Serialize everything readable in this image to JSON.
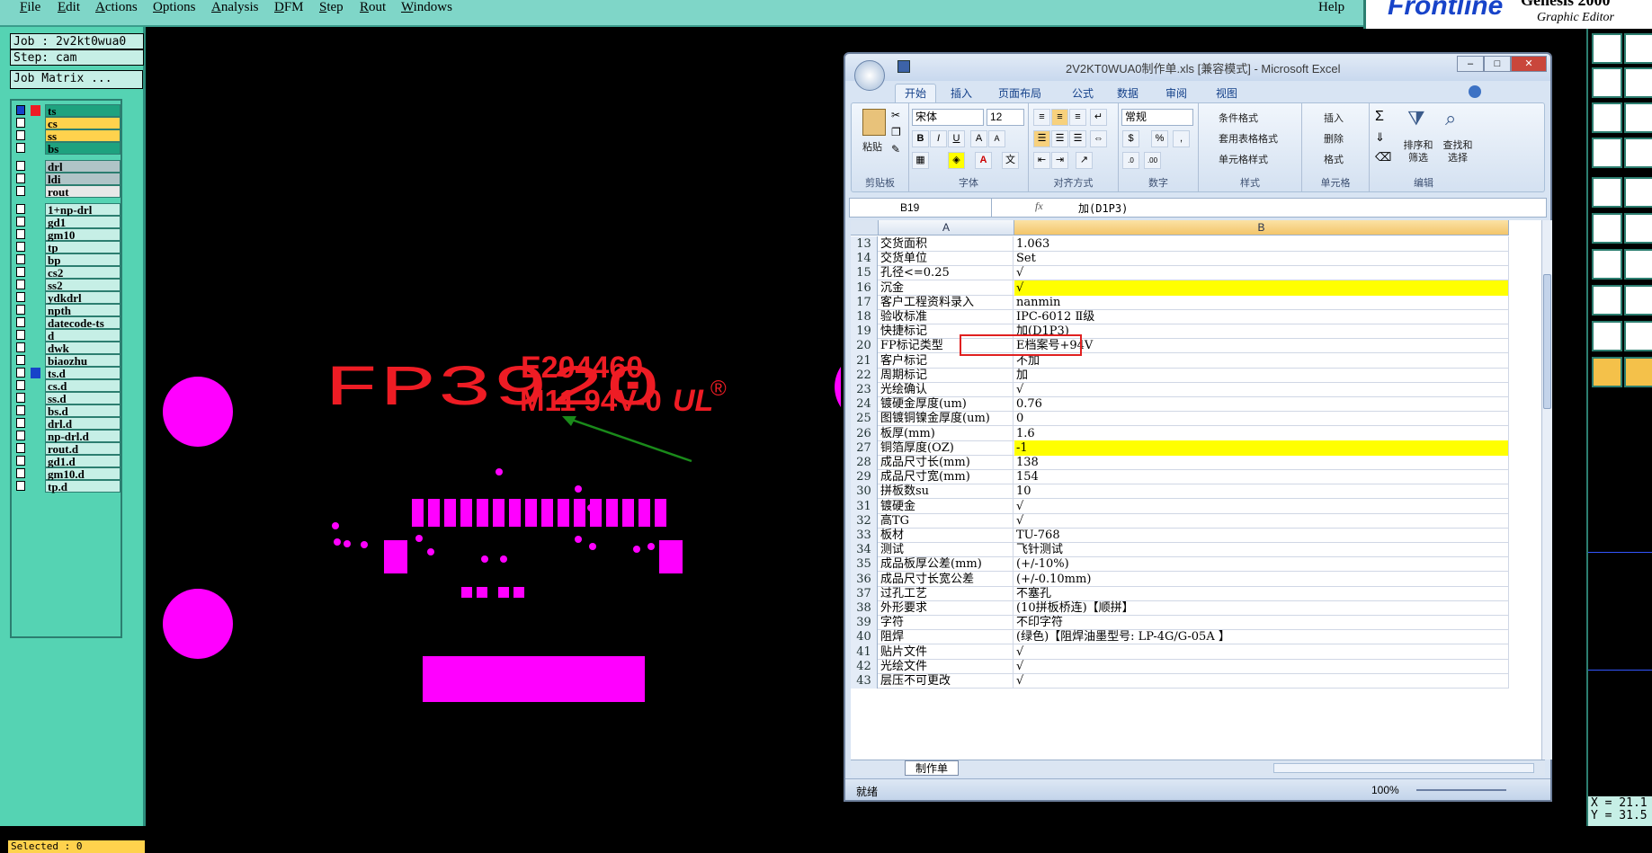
{
  "menubar": {
    "items": [
      {
        "label": "File",
        "u": "F"
      },
      {
        "label": "Edit",
        "u": "E"
      },
      {
        "label": "Actions",
        "u": "A"
      },
      {
        "label": "Options",
        "u": "O"
      },
      {
        "label": "Analysis",
        "u": "A"
      },
      {
        "label": "DFM",
        "u": "D"
      },
      {
        "label": "Step",
        "u": "S"
      },
      {
        "label": "Rout",
        "u": "R"
      },
      {
        "label": "Windows",
        "u": "W"
      }
    ],
    "help": "Help",
    "logo": "Frontline",
    "logo_product": "Genesis 2000",
    "logo_sub": "Graphic Editor"
  },
  "left": {
    "job": "Job : 2v2kt0wua0",
    "step": "Step: cam",
    "matrix_button": "Job Matrix ...",
    "selected": "Selected : 0",
    "layers": [
      "ts",
      "cs",
      "ss",
      "bs",
      "drl",
      "ldi",
      "rout",
      "1+np-drl",
      "gd1",
      "gm10",
      "tp",
      "bp",
      "cs2",
      "ss2",
      "ydkdrl",
      "npth",
      "datecode-ts",
      "d",
      "dwk",
      "biaozhu",
      "ts.d",
      "cs.d",
      "ss.d",
      "bs.d",
      "drl.d",
      "np-drl.d",
      "rout.d",
      "gd1.d",
      "gm10.d",
      "tp.d"
    ]
  },
  "canvas": {
    "fp_text": "FP3920",
    "ul_number": "E204460",
    "ul_rating": "M11 94V-0",
    "ul_mark": "UL",
    "registered": "®"
  },
  "coords": {
    "x": "X = 21.1",
    "y": "Y = 31.5"
  },
  "excel": {
    "title": "2V2KT0WUA0制作单.xls [兼容模式] - Microsoft Excel",
    "tabs": [
      "开始",
      "插入",
      "页面布局",
      "公式",
      "数据",
      "审阅",
      "视图"
    ],
    "ribbon": {
      "paste": "粘贴",
      "clipboard": "剪贴板",
      "font_name": "宋体",
      "font_size": "12",
      "font": "字体",
      "align": "对齐方式",
      "number_format": "常规",
      "number": "数字",
      "cond_format": "条件格式",
      "table_format": "套用表格格式",
      "cell_style": "单元格样式",
      "styles": "样式",
      "insert": "插入",
      "delete": "删除",
      "format": "格式",
      "cells": "单元格",
      "sort_filter": "排序和筛选",
      "find_select": "查找和选择",
      "editing": "编辑"
    },
    "namebox": "B19",
    "fx": "fx",
    "formula": "加(D1P3)",
    "col_a": "A",
    "col_b": "B",
    "rows": [
      {
        "n": "13",
        "a": "交货面积",
        "b": "1.063",
        "y": false
      },
      {
        "n": "14",
        "a": "交货单位",
        "b": "Set",
        "y": false
      },
      {
        "n": "15",
        "a": "孔径<=0.25",
        "b": "√",
        "y": false
      },
      {
        "n": "16",
        "a": "沉金",
        "b": "√",
        "y": true
      },
      {
        "n": "17",
        "a": "客户工程资料录入",
        "b": "nanmin",
        "y": false
      },
      {
        "n": "18",
        "a": "验收标准",
        "b": "IPC-6012 Ⅱ级",
        "y": false
      },
      {
        "n": "19",
        "a": "快捷标记",
        "b": "加(D1P3)",
        "y": false
      },
      {
        "n": "20",
        "a": "FP标记类型",
        "b": "E档案号+94V",
        "y": false
      },
      {
        "n": "21",
        "a": "客户标记",
        "b": "不加",
        "y": false
      },
      {
        "n": "22",
        "a": "周期标记",
        "b": "加",
        "y": false
      },
      {
        "n": "23",
        "a": "光绘确认",
        "b": "√",
        "y": false
      },
      {
        "n": "24",
        "a": "镀硬金厚度(um)",
        "b": "0.76",
        "y": false
      },
      {
        "n": "25",
        "a": "图镀铜镍金厚度(um)",
        "b": "0",
        "y": false
      },
      {
        "n": "26",
        "a": "板厚(mm)",
        "b": "1.6",
        "y": false
      },
      {
        "n": "27",
        "a": "铜箔厚度(OZ)",
        "b": "-1",
        "y": true
      },
      {
        "n": "28",
        "a": "成品尺寸长(mm)",
        "b": "138",
        "y": false
      },
      {
        "n": "29",
        "a": "成品尺寸宽(mm)",
        "b": "154",
        "y": false
      },
      {
        "n": "30",
        "a": "拼板数su",
        "b": "10",
        "y": false
      },
      {
        "n": "31",
        "a": "镀硬金",
        "b": "√",
        "y": false
      },
      {
        "n": "32",
        "a": "高TG",
        "b": "√",
        "y": false
      },
      {
        "n": "33",
        "a": "板材",
        "b": "TU-768",
        "y": false
      },
      {
        "n": "34",
        "a": "测试",
        "b": "飞针测试",
        "y": false
      },
      {
        "n": "35",
        "a": "成品板厚公差(mm)",
        "b": "(+/-10%)",
        "y": false
      },
      {
        "n": "36",
        "a": "成品尺寸长宽公差",
        "b": "(+/-0.10mm)",
        "y": false
      },
      {
        "n": "37",
        "a": "过孔工艺",
        "b": "不塞孔",
        "y": false
      },
      {
        "n": "38",
        "a": "外形要求",
        "b": "(10拼板桥连)【顺拼】",
        "y": false
      },
      {
        "n": "39",
        "a": "字符",
        "b": "不印字符",
        "y": false
      },
      {
        "n": "40",
        "a": "阻焊",
        "b": "(绿色)【阻焊油墨型号: LP-4G/G-05A 】",
        "y": false
      },
      {
        "n": "41",
        "a": "贴片文件",
        "b": "√",
        "y": false
      },
      {
        "n": "42",
        "a": "光绘文件",
        "b": "√",
        "y": false
      },
      {
        "n": "43",
        "a": "层压不可更改",
        "b": "√",
        "y": false
      }
    ],
    "sheet": "制作单",
    "status": "就绪",
    "zoom": "100%"
  },
  "colors": {
    "accent": "#55d3b3",
    "magenta": "#ff00ff",
    "red_text": "#ee1c24",
    "arrow": "#1a8a1a",
    "highlight": "#ffff00"
  }
}
